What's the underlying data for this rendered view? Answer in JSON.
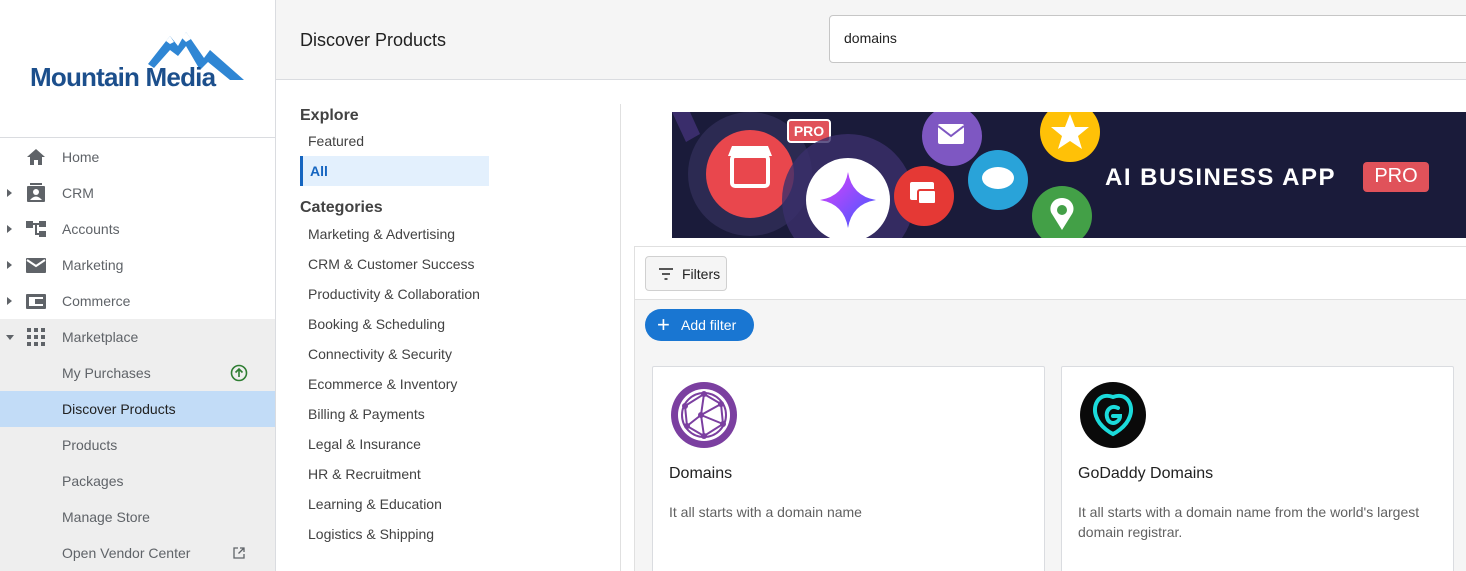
{
  "brand": {
    "name": "Mountain Media",
    "color": "#1c4f8c"
  },
  "sidebar": {
    "items": [
      {
        "label": "Home",
        "icon": "home-icon",
        "expandable": false
      },
      {
        "label": "CRM",
        "icon": "contacts-icon",
        "expandable": true
      },
      {
        "label": "Accounts",
        "icon": "hierarchy-icon",
        "expandable": true
      },
      {
        "label": "Marketing",
        "icon": "mail-icon",
        "expandable": true
      },
      {
        "label": "Commerce",
        "icon": "wallet-icon",
        "expandable": true
      },
      {
        "label": "Marketplace",
        "icon": "apps-grid-icon",
        "expandable": true,
        "expanded": true
      }
    ],
    "marketplace_children": [
      {
        "label": "My Purchases",
        "badge_icon": "arrow-up-circle-icon"
      },
      {
        "label": "Discover Products",
        "active": true
      },
      {
        "label": "Products"
      },
      {
        "label": "Packages"
      },
      {
        "label": "Manage Store"
      },
      {
        "label": "Open Vendor Center",
        "badge_icon": "external-link-icon"
      }
    ]
  },
  "header": {
    "title": "Discover Products",
    "search_value": "domains"
  },
  "menu": {
    "explore_heading": "Explore",
    "explore_items": [
      "Featured",
      "All"
    ],
    "active_explore": "All",
    "categories_heading": "Categories",
    "categories": [
      "Marketing & Advertising",
      "CRM & Customer Success",
      "Productivity & Collaboration",
      "Booking & Scheduling",
      "Connectivity & Security",
      "Ecommerce & Inventory",
      "Billing & Payments",
      "Legal & Insurance",
      "HR & Recruitment",
      "Learning & Education",
      "Logistics & Shipping"
    ]
  },
  "banner": {
    "headline": "AI BUSINESS APP",
    "badge": "PRO",
    "store_badge": "PRO"
  },
  "toolbar": {
    "filters_label": "Filters",
    "add_filter_label": "Add filter"
  },
  "products": [
    {
      "name": "Domains",
      "description": "It all starts with a domain name",
      "icon": "globe-network-icon"
    },
    {
      "name": "GoDaddy Domains",
      "description": "It all starts with a domain name from the world's largest domain registrar.",
      "icon": "godaddy-logo-icon"
    }
  ],
  "colors": {
    "accent": "#1976d2",
    "active_nav": "#c2dcf7",
    "banner_bg": "#1a1b3a",
    "pro_badge": "#e0525a"
  }
}
